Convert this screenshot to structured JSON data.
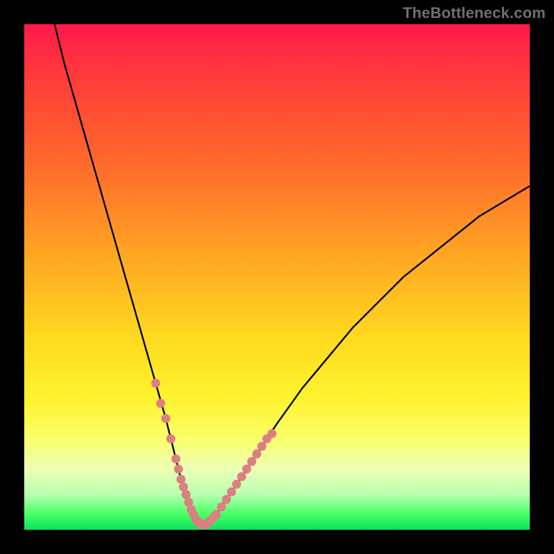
{
  "attribution": "TheBottleneck.com",
  "colors": {
    "page_bg": "#000000",
    "gradient_top": "#ff1a4d",
    "gradient_bottom": "#09e35a",
    "curve": "#000000",
    "highlight_dots": "#dc7f82",
    "attribution_text": "#6f6f6f"
  },
  "chart_data": {
    "type": "line",
    "title": "",
    "xlabel": "",
    "ylabel": "",
    "xlim": [
      0,
      100
    ],
    "ylim": [
      0,
      100
    ],
    "grid": false,
    "legend": false,
    "series": [
      {
        "name": "bottleneck-curve",
        "x": [
          6,
          8,
          10,
          12,
          14,
          16,
          18,
          20,
          22,
          24,
          26,
          28,
          30,
          31,
          32,
          33,
          34,
          35,
          36,
          37,
          38,
          40,
          42,
          44,
          46,
          50,
          55,
          60,
          65,
          70,
          75,
          80,
          85,
          90,
          95,
          100
        ],
        "y": [
          100,
          92,
          85,
          78,
          71,
          64,
          57,
          50,
          43,
          36,
          29,
          22,
          14,
          10,
          7,
          4,
          2,
          1,
          1,
          2,
          3,
          6,
          9,
          12,
          15,
          21,
          28,
          34,
          40,
          45,
          50,
          54,
          58,
          62,
          65,
          68
        ]
      }
    ],
    "highlight_segments": [
      {
        "name": "left-arm-dots",
        "x": [
          26,
          27,
          28,
          29,
          30,
          30.5,
          31,
          31.5,
          32,
          32.5,
          33,
          33.5,
          34,
          34.5,
          35,
          35.5,
          36
        ],
        "y": [
          29,
          25,
          22,
          18,
          14,
          12,
          10,
          8.5,
          7,
          5.5,
          4,
          3,
          2,
          1.5,
          1,
          1,
          1
        ]
      },
      {
        "name": "right-arm-dots",
        "x": [
          36.5,
          37,
          37.5,
          38,
          39,
          40,
          41,
          42,
          43,
          44,
          45,
          46,
          47,
          48,
          49
        ],
        "y": [
          1.5,
          2,
          2.5,
          3,
          4.5,
          6,
          7.5,
          9,
          10.5,
          12,
          13.5,
          15,
          16.5,
          18,
          19
        ]
      }
    ]
  }
}
